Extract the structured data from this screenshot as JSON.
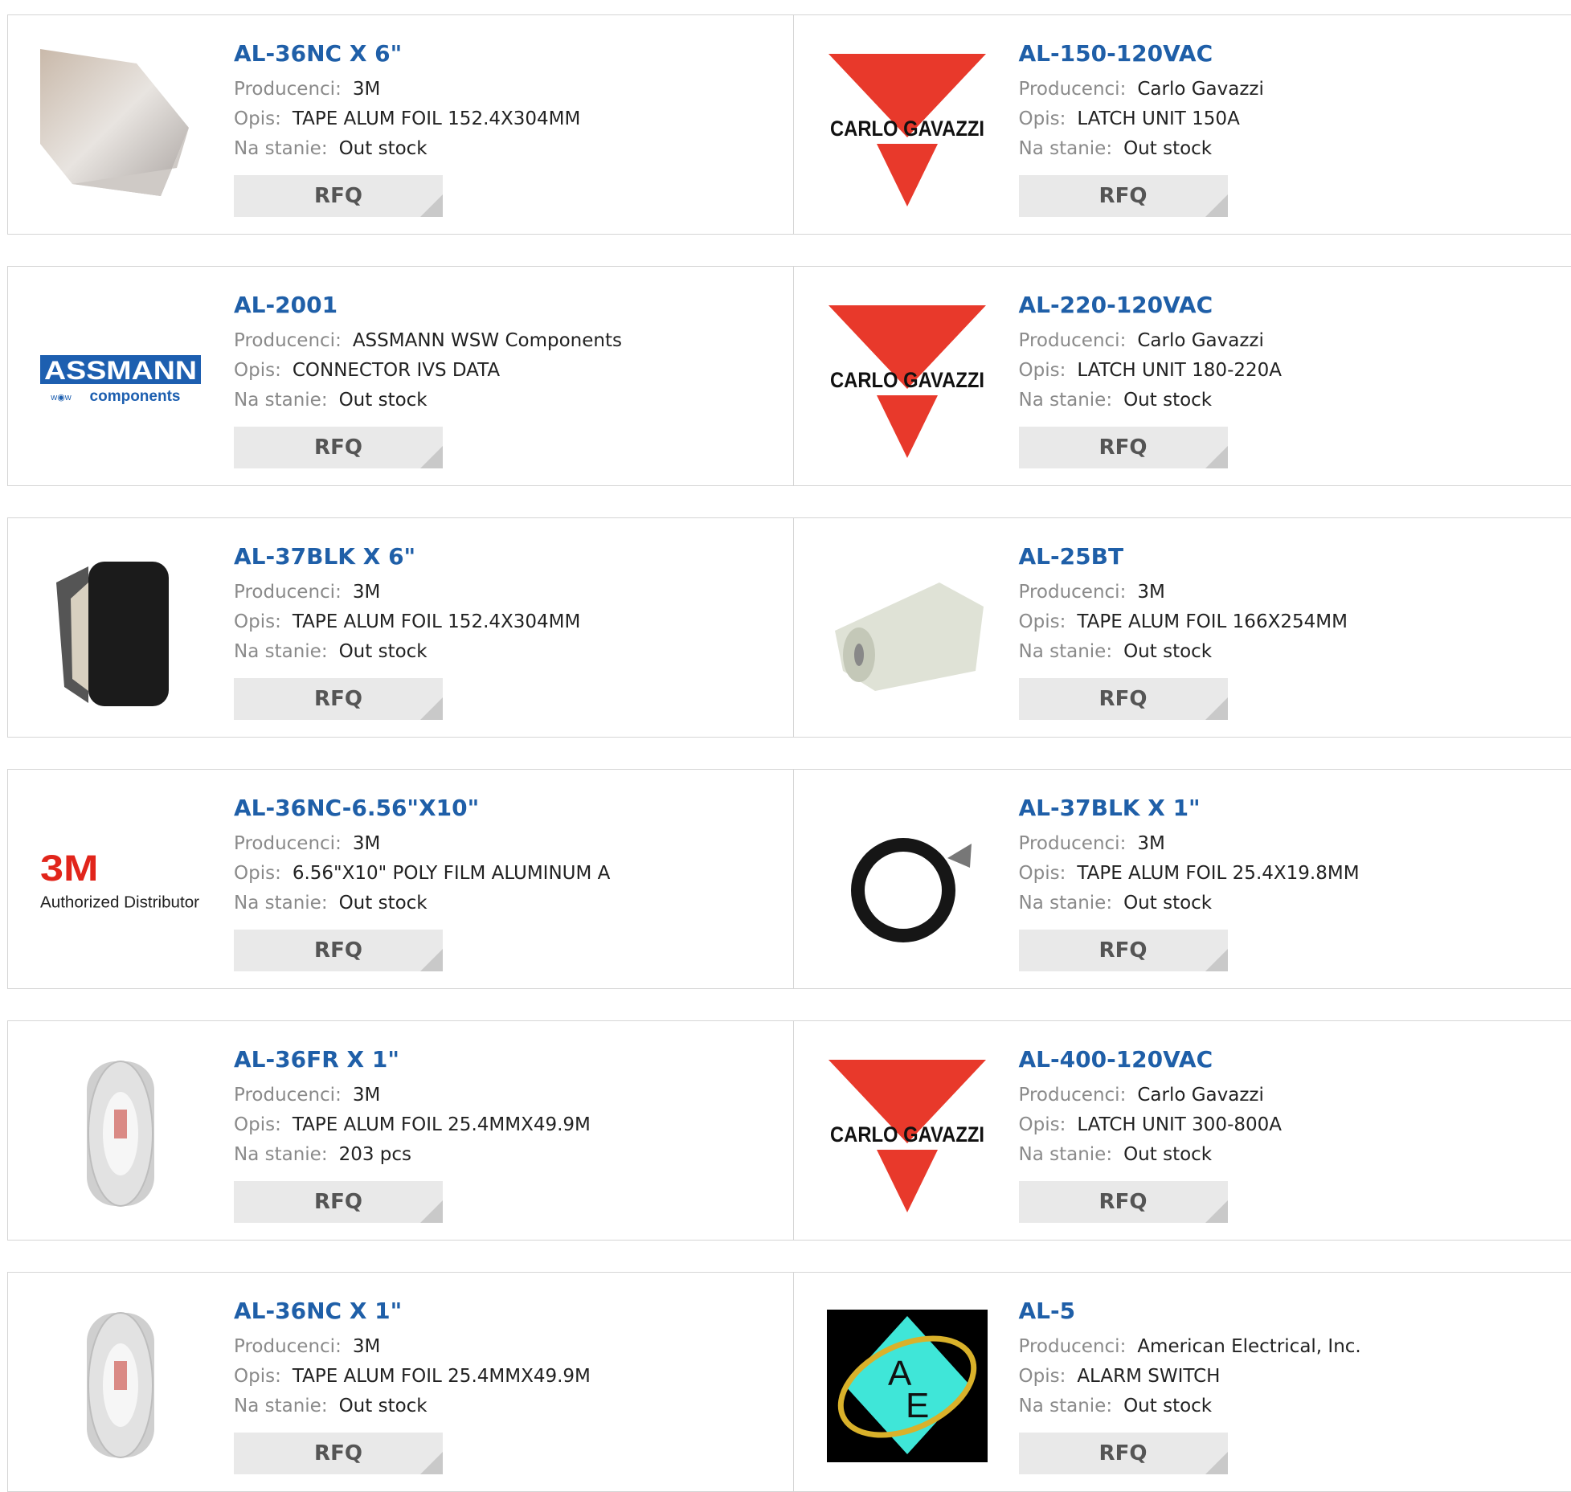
{
  "labels": {
    "manufacturer": "Producenci:",
    "description": "Opis:",
    "stock": "Na stanie:",
    "rfq": "RFQ"
  },
  "logos": {
    "carlo_gavazzi": "CARLO GAVAZZI",
    "assmann_top": "ASSMANN",
    "assmann_bottom": "components",
    "threem": "3M",
    "threem_sub": "Authorized Distributor",
    "ae": "AE"
  },
  "colors": {
    "title": "#1f5fa8",
    "label": "#8a8a8a",
    "rfq_bg": "#e9e9e9",
    "carlo_red": "#e8392b",
    "assmann_blue": "#1d5fb0",
    "threem_red": "#e1251b",
    "ae_cyan": "#3fe6d8",
    "ae_gold": "#d9b12a"
  },
  "products": [
    {
      "part": "AL-36NC X 6\"",
      "manufacturer": "3M",
      "description": "TAPE ALUM FOIL 152.4X304MM",
      "stock": "Out stock",
      "image": "foil-sheet-image"
    },
    {
      "part": "AL-150-120VAC",
      "manufacturer": "Carlo Gavazzi",
      "description": "LATCH UNIT 150A",
      "stock": "Out stock",
      "image": "carlo-gavazzi-logo"
    },
    {
      "part": "AL-2001",
      "manufacturer": "ASSMANN WSW Components",
      "description": "CONNECTOR IVS DATA",
      "stock": "Out stock",
      "image": "assmann-logo"
    },
    {
      "part": "AL-220-120VAC",
      "manufacturer": "Carlo Gavazzi",
      "description": "LATCH UNIT 180-220A",
      "stock": "Out stock",
      "image": "carlo-gavazzi-logo"
    },
    {
      "part": "AL-37BLK X 6\"",
      "manufacturer": "3M",
      "description": "TAPE ALUM FOIL 152.4X304MM",
      "stock": "Out stock",
      "image": "black-tape-roll-image"
    },
    {
      "part": "AL-25BT",
      "manufacturer": "3M",
      "description": "TAPE ALUM FOIL 166X254MM",
      "stock": "Out stock",
      "image": "foil-roll-image"
    },
    {
      "part": "AL-36NC-6.56\"X10\"",
      "manufacturer": "3M",
      "description": "6.56\"X10\" POLY FILM ALUMINUM A",
      "stock": "Out stock",
      "image": "3m-distributor-logo"
    },
    {
      "part": "AL-37BLK X 1\"",
      "manufacturer": "3M",
      "description": "TAPE ALUM FOIL 25.4X19.8MM",
      "stock": "Out stock",
      "image": "black-tape-ring-image"
    },
    {
      "part": "AL-36FR X 1\"",
      "manufacturer": "3M",
      "description": "TAPE ALUM FOIL 25.4MMX49.9M",
      "stock": "203 pcs",
      "image": "tape-spool-image"
    },
    {
      "part": "AL-400-120VAC",
      "manufacturer": "Carlo Gavazzi",
      "description": "LATCH UNIT 300-800A",
      "stock": "Out stock",
      "image": "carlo-gavazzi-logo"
    },
    {
      "part": "AL-36NC X 1\"",
      "manufacturer": "3M",
      "description": "TAPE ALUM FOIL 25.4MMX49.9M",
      "stock": "Out stock",
      "image": "tape-spool-image"
    },
    {
      "part": "AL-5",
      "manufacturer": "American Electrical, Inc.",
      "description": "ALARM SWITCH",
      "stock": "Out stock",
      "image": "american-electrical-logo"
    }
  ]
}
